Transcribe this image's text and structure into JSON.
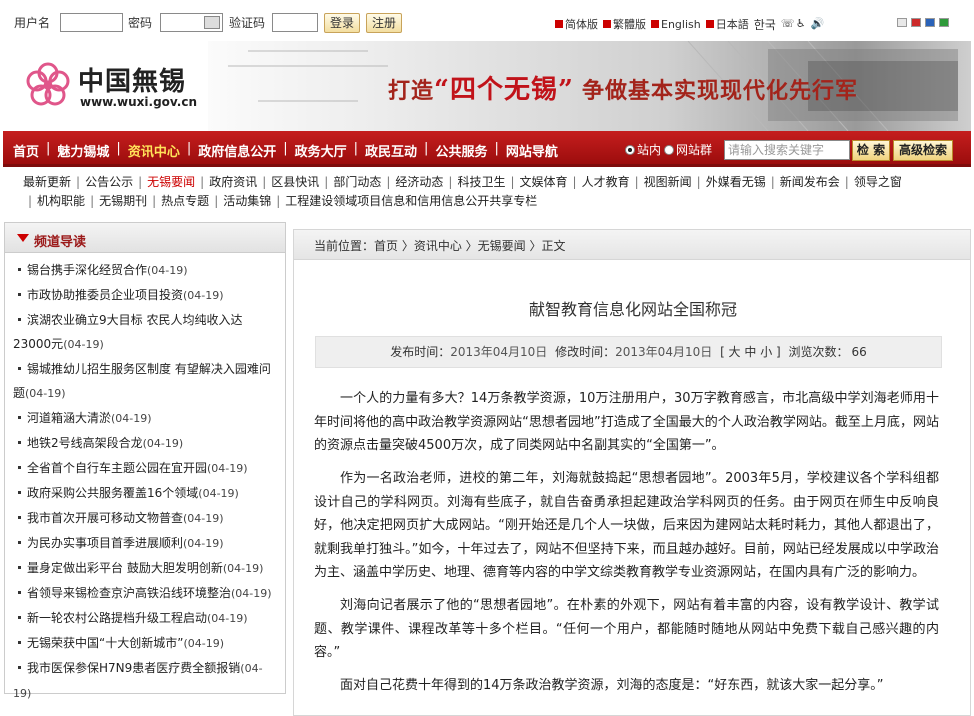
{
  "login": {
    "username_label": "用户名",
    "password_label": "密码",
    "captcha_label": "验证码",
    "login_button": "登录",
    "register_button": "注册"
  },
  "languages": [
    "简体版",
    "繁體版",
    "English",
    "日本語",
    "한국"
  ],
  "accessibility_icons": [
    "phone-icon",
    "wheelchair-icon",
    "speaker-icon"
  ],
  "theme_swatches": [
    "#e8e8e8",
    "#cc2a2a",
    "#2a62b8",
    "#2f9a3a"
  ],
  "site": {
    "logo_text": "中国無锡",
    "logo_url": "www.wuxi.gov.cn",
    "slogan_prefix": "打造",
    "slogan_quote": "“四个无锡”",
    "slogan_suffix": "争做基本实现现代化先行军"
  },
  "nav": {
    "items": [
      "首页",
      "魅力锡城",
      "资讯中心",
      "政府信息公开",
      "政务大厅",
      "政民互动",
      "公共服务",
      "网站导航"
    ],
    "active": 2,
    "active_color": "#ffe35a",
    "radio_site": "站内",
    "radio_group": "网站群",
    "search_placeholder": "请输入搜索关键字",
    "search_button": "检 索",
    "advanced_button": "高级检索"
  },
  "subnav": {
    "items": [
      "最新更新",
      "公告公示",
      "无锡要闻",
      "政府资讯",
      "区县快讯",
      "部门动态",
      "经济动态",
      "科技卫生",
      "文娱体育",
      "人才教育",
      "视图新闻",
      "外媒看无锡",
      "新闻发布会",
      "领导之窗",
      "机构职能",
      "无锡期刊",
      "热点专题",
      "活动集锦",
      "工程建设领域项目信息和信用信息公开共享专栏"
    ],
    "active": 2,
    "active_color": "#cc0000"
  },
  "sidebar": {
    "title": "频道导读",
    "items": [
      {
        "title": "锡台携手深化经贸合作",
        "date": "(04-19)"
      },
      {
        "title": "市政协助推委员企业项目投资",
        "date": "(04-19)"
      },
      {
        "title": "滨湖农业确立9大目标 农民人均纯收入达23000元",
        "date": "(04-19)"
      },
      {
        "title": "锡城推幼儿招生服务区制度 有望解决入园难问题",
        "date": "(04-19)"
      },
      {
        "title": "河道箱涵大清淤",
        "date": "(04-19)"
      },
      {
        "title": "地铁2号线高架段合龙",
        "date": "(04-19)"
      },
      {
        "title": "全省首个自行车主题公园在宜开园",
        "date": "(04-19)"
      },
      {
        "title": "政府采购公共服务覆盖16个领域",
        "date": "(04-19)"
      },
      {
        "title": "我市首次开展可移动文物普查",
        "date": "(04-19)"
      },
      {
        "title": "为民办实事项目首季进展顺利",
        "date": "(04-19)"
      },
      {
        "title": "量身定做出彩平台 鼓励大胆发明创新",
        "date": "(04-19)"
      },
      {
        "title": "省领导来锡检查京沪高铁沿线环境整治",
        "date": "(04-19)"
      },
      {
        "title": "新一轮农村公路提档升级工程启动",
        "date": "(04-19)"
      },
      {
        "title": "无锡荣获中国“十大创新城市”",
        "date": "(04-19)"
      },
      {
        "title": "我市医保参保H7N9患者医疗费全额报销",
        "date": "(04-19)"
      }
    ]
  },
  "article": {
    "breadcrumb": "当前位置：首页 〉资讯中心 〉无锡要闻 〉正文",
    "title": "献智教育信息化网站全国称冠",
    "meta_label_publish": "发布时间：",
    "publish_date": "2013年04月10日",
    "meta_label_modify": "修改时间：",
    "modify_date": "2013年04月10日",
    "font_sizes": "[ 大 中 小 ]",
    "views_label": "浏览次数：",
    "views": "66",
    "paragraphs": [
      "一个人的力量有多大？14万条教学资源，10万注册用户，30万字教育感言，市北高级中学刘海老师用十年时间将他的高中政治教学资源网站“思想者园地”打造成了全国最大的个人政治教学网站。截至上月底，网站的资源点击量突破4500万次，成了同类网站中名副其实的“全国第一”。",
      "作为一名政治老师，进校的第二年，刘海就鼓捣起“思想者园地”。2003年5月，学校建议各个学科组都设计自己的学科网页。刘海有些底子，就自告奋勇承担起建政治学科网页的任务。由于网页在师生中反响良好，他决定把网页扩大成网站。“刚开始还是几个人一块做，后来因为建网站太耗时耗力，其他人都退出了，就剩我单打独斗。”如今，十年过去了，网站不但坚持下来，而且越办越好。目前，网站已经发展成以中学政治为主、涵盖中学历史、地理、德育等内容的中学文综类教育教学专业资源网站，在国内具有广泛的影响力。",
      "刘海向记者展示了他的“思想者园地”。在朴素的外观下，网站有着丰富的内容，设有教学设计、教学试题、教学课件、课程改革等十多个栏目。“任何一个用户，都能随时随地从网站中免费下载自己感兴趣的内容。”",
      "面对自己花费十年得到的14万条政治教学资源，刘海的态度是：“好东西，就该大家一起分享。”"
    ]
  }
}
